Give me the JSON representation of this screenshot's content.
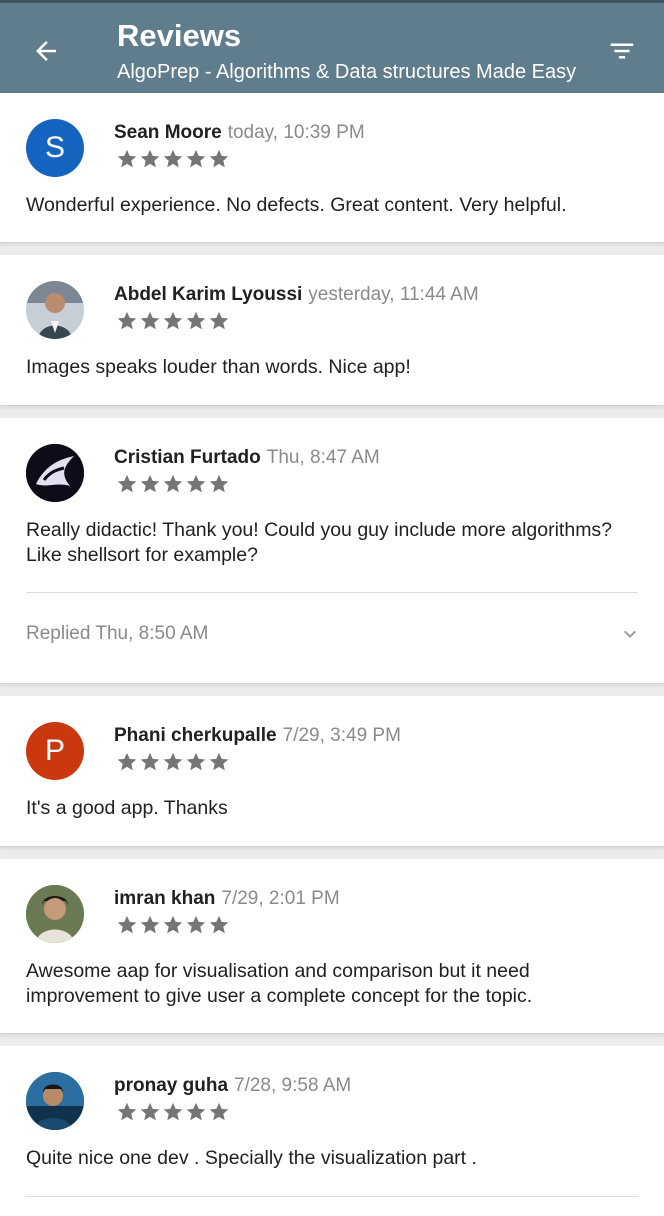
{
  "appbar": {
    "title": "Reviews",
    "subtitle": "AlgoPrep - Algorithms & Data structures Made Easy",
    "back_icon": "arrow-back-icon",
    "filter_icon": "filter-icon"
  },
  "reviews": [
    {
      "author": "Sean Moore",
      "date": "today, 10:39 PM",
      "rating": 5,
      "text": "Wonderful experience. No defects. Great content. Very helpful.",
      "avatar_letter": "S",
      "avatar_color": "#1565c0"
    },
    {
      "author": "Abdel Karim Lyoussi",
      "date": "yesterday, 11:44 AM",
      "rating": 5,
      "text": "Images speaks louder than words. Nice app!",
      "avatar_letter": "",
      "avatar_color": "#6a7a8c"
    },
    {
      "author": "Cristian Furtado",
      "date": "Thu, 8:47 AM",
      "rating": 5,
      "text": "Really didactic! Thank you! Could you guy include more algorithms? Like shellsort for example?",
      "avatar_letter": "",
      "avatar_color": "#0d0d1a",
      "reply_status": "Replied Thu, 8:50 AM"
    },
    {
      "author": "Phani cherkupalle",
      "date": "7/29, 3:49 PM",
      "rating": 5,
      "text": "It's a good app. Thanks",
      "avatar_letter": "P",
      "avatar_color": "#c9380f"
    },
    {
      "author": "imran khan",
      "date": "7/29, 2:01 PM",
      "rating": 5,
      "text": "Awesome aap for visualisation and comparison but it need improvement to give user a complete concept for the topic.",
      "avatar_letter": "",
      "avatar_color": "#5d6b4a"
    },
    {
      "author": "pronay guha",
      "date": "7/28, 9:58 AM",
      "rating": 5,
      "text": "Quite nice one dev . Specially the visualization part .",
      "avatar_letter": "",
      "avatar_color": "#1e5a86"
    }
  ],
  "colors": {
    "appbar": "#5f7d8c",
    "star": "#757575",
    "date": "#8a8a8a"
  }
}
